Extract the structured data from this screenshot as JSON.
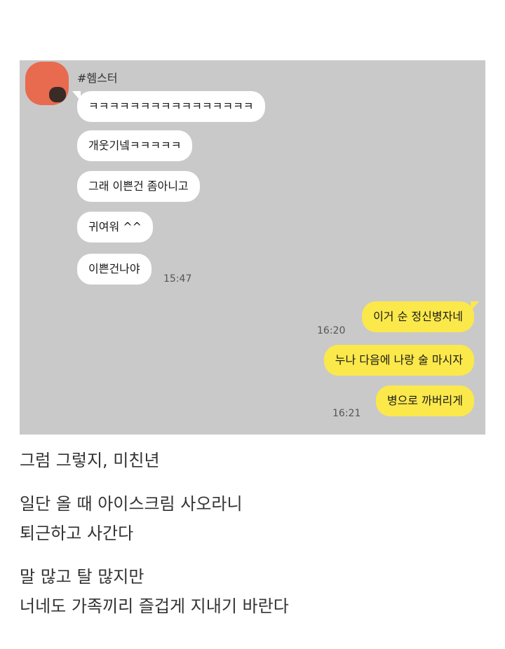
{
  "chat": {
    "sender_name": "#헴스터",
    "incoming": [
      "ㅋㅋㅋㅋㅋㅋㅋㅋㅋㅋㅋㅋㅋㅋㅋㅋ",
      "개웃기넼ㅋㅋㅋㅋㅋ",
      "그래 이쁜건 좀아니고",
      "귀여워 ^^",
      "이쁜건나야"
    ],
    "incoming_time": "15:47",
    "outgoing": [
      {
        "text": "이거 순 정신병자네",
        "time": "16:20"
      },
      {
        "text": "누나 다음에 나랑 술 마시자",
        "time": ""
      },
      {
        "text": "병으로 까버리게",
        "time": "16:21"
      }
    ]
  },
  "caption": {
    "line1": "그럼 그렇지, 미친년",
    "line2": "일단 올 때 아이스크림 사오라니",
    "line3": "퇴근하고 사간다",
    "line4": "말 많고 탈 많지만",
    "line5": "너네도 가족끼리 즐겁게 지내기 바란다"
  }
}
